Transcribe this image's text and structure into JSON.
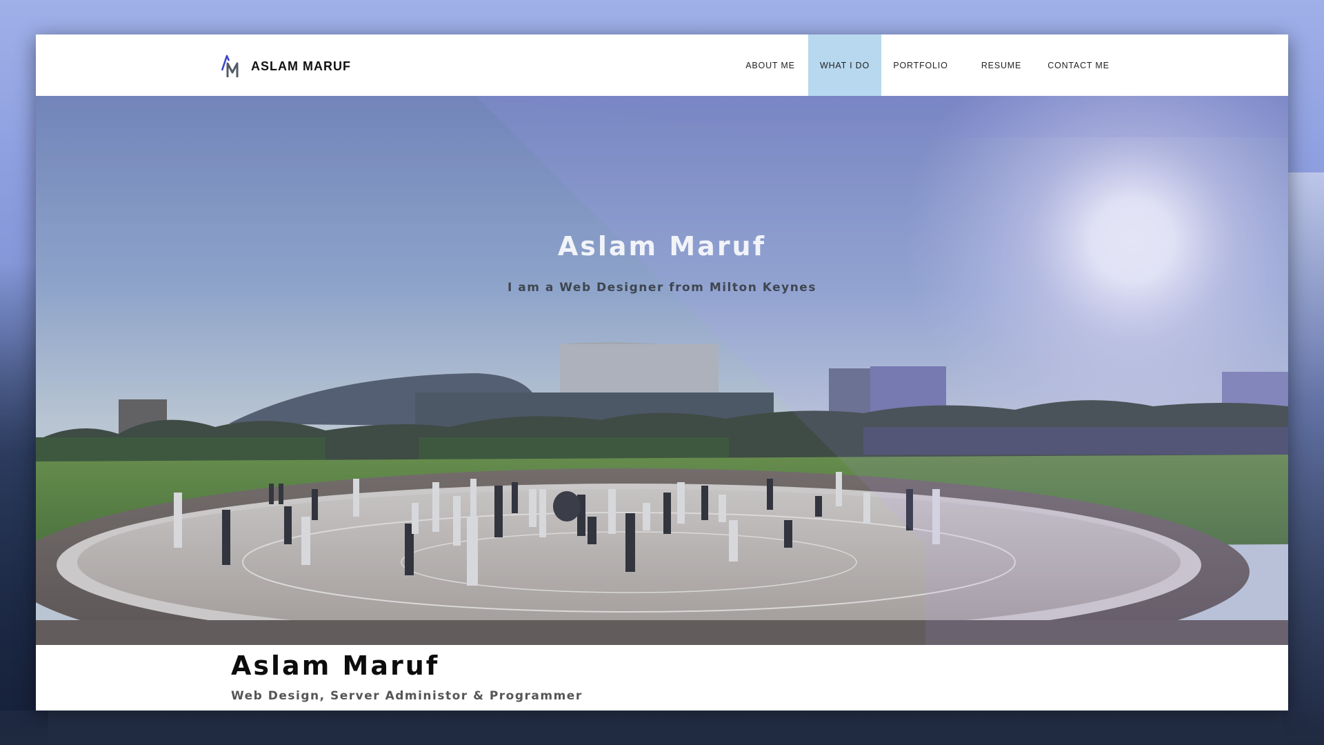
{
  "brand": {
    "name": "ASLAM MARUF",
    "logo_icon": "am-monogram-icon",
    "accent": "#3c46c8"
  },
  "nav": {
    "items": [
      {
        "label": "ABOUT ME",
        "active": false
      },
      {
        "label": "WHAT I DO",
        "active": true
      },
      {
        "label": "PORTFOLIO",
        "active": false
      },
      {
        "label": "RESUME",
        "active": false
      },
      {
        "label": "CONTACT ME",
        "active": false
      }
    ],
    "active_color": "#b7d8ee"
  },
  "hero": {
    "title": "Aslam Maruf",
    "subtitle": "I am a Web Designer from Milton Keynes",
    "image": "milton-keynes-plaza-photo"
  },
  "footer": {
    "name": "Aslam Maruf",
    "role": "Web Design, Server Administor & Programmer"
  }
}
